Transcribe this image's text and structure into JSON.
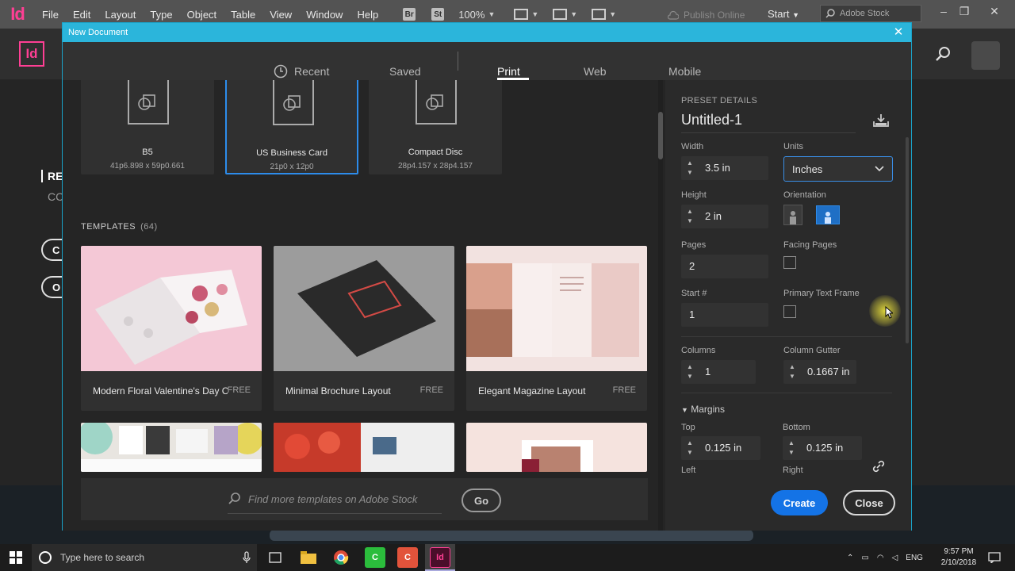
{
  "app": {
    "logo": "Id",
    "menu": [
      "File",
      "Edit",
      "Layout",
      "Type",
      "Object",
      "Table",
      "View",
      "Window",
      "Help"
    ],
    "bridge_icon": "Br",
    "stock_icon": "St",
    "zoom": "100%",
    "publish_online": "Publish Online",
    "workspace": "Start",
    "stock_search_placeholder": "Adobe Stock"
  },
  "background": {
    "logo": "Id",
    "recent_label": "REC",
    "cc_label": "CC",
    "btn1": "C",
    "btn2": "O"
  },
  "dialog": {
    "title": "New Document",
    "tabs": [
      "Recent",
      "Saved",
      "Print",
      "Web",
      "Mobile"
    ],
    "active_tab": "Print",
    "presets": [
      {
        "name": "B5",
        "size": "41p6.898 x 59p0.661"
      },
      {
        "name": "US Business Card",
        "size": "21p0 x 12p0"
      },
      {
        "name": "Compact Disc",
        "size": "28p4.157 x 28p4.157"
      }
    ],
    "templates_label": "TEMPLATES",
    "templates_count": "(64)",
    "templates": [
      {
        "name": "Modern Floral Valentine's Day Ca...",
        "badge": "FREE"
      },
      {
        "name": "Minimal Brochure Layout",
        "badge": "FREE"
      },
      {
        "name": "Elegant Magazine Layout",
        "badge": "FREE"
      }
    ],
    "stock_search_placeholder": "Find more templates on Adobe Stock",
    "go_label": "Go"
  },
  "details": {
    "section_label": "PRESET DETAILS",
    "doc_name": "Untitled-1",
    "width_label": "Width",
    "width": "3.5 in",
    "units_label": "Units",
    "units": "Inches",
    "height_label": "Height",
    "height": "2 in",
    "orientation_label": "Orientation",
    "pages_label": "Pages",
    "pages": "2",
    "facing_pages_label": "Facing Pages",
    "start_label": "Start #",
    "start": "1",
    "primary_text_frame_label": "Primary Text Frame",
    "columns_label": "Columns",
    "columns": "1",
    "gutter_label": "Column Gutter",
    "gutter": "0.1667 in",
    "margins_label": "Margins",
    "top_label": "Top",
    "top": "0.125 in",
    "bottom_label": "Bottom",
    "bottom": "0.125 in",
    "left_label": "Left",
    "right_label": "Right",
    "create_label": "Create",
    "close_label": "Close"
  },
  "taskbar": {
    "search_placeholder": "Type here to search",
    "lang": "ENG",
    "time": "9:57 PM",
    "date": "2/10/2018"
  },
  "colors": {
    "accent_blue": "#1473e6",
    "title_bar": "#2bb5db",
    "indesign_pink": "#ff3f94"
  }
}
